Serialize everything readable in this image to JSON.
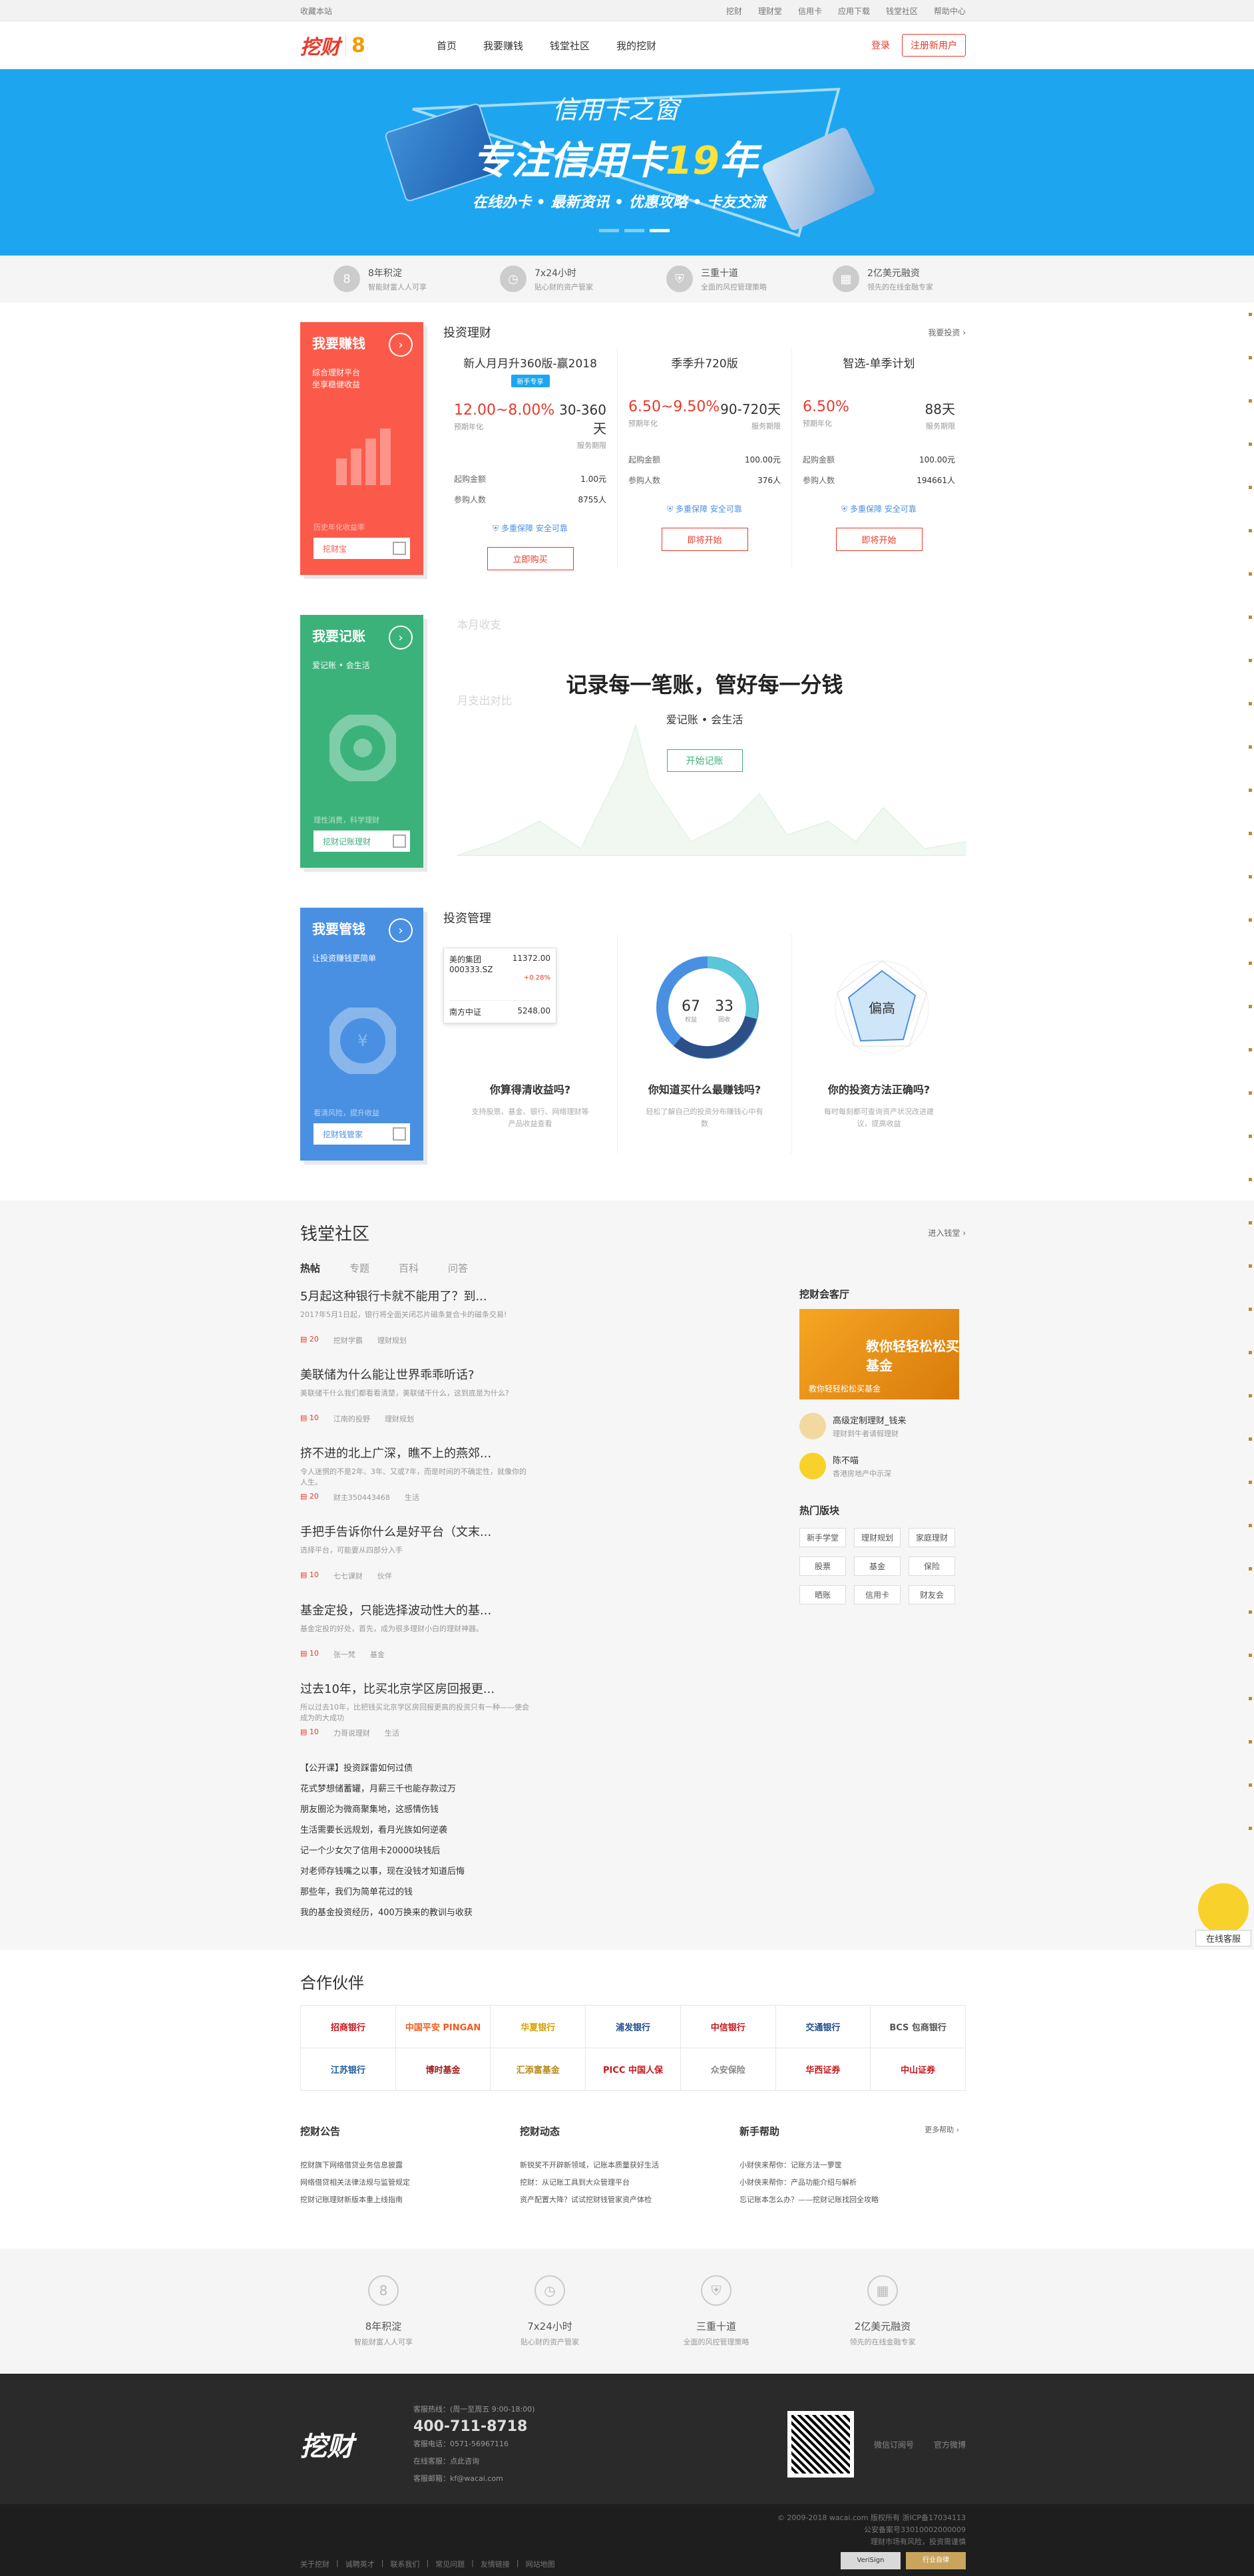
{
  "topbar": {
    "left": "收藏本站",
    "links": [
      "挖财",
      "理财堂",
      "信用卡",
      "应用下载",
      "钱堂社区",
      "帮助中心"
    ]
  },
  "header": {
    "logo": "挖财",
    "logo_mark": "8",
    "nav": [
      "首页",
      "我要赚钱",
      "钱堂社区",
      "我的挖财"
    ],
    "login": "登录",
    "register": "注册新用户"
  },
  "banner": {
    "subtitle": "信用卡之窗",
    "title_pre": "专注信用卡",
    "title_num": "19",
    "title_post": "年",
    "tags": "在线办卡 • 最新资讯 • 优惠攻略 • 卡友交流"
  },
  "features": [
    {
      "icon": "8",
      "t1": "8年积淀",
      "t2": "智能财富人人可享"
    },
    {
      "icon": "◷",
      "t1": "7x24小时",
      "t2": "贴心财的资产管家"
    },
    {
      "icon": "⛨",
      "t1": "三重十道",
      "t2": "全面的风控管理策略"
    },
    {
      "icon": "▦",
      "t1": "2亿美元融资",
      "t2": "领先的在线金融专家"
    }
  ],
  "earn": {
    "side_title": "我要赚钱",
    "side_desc1": "综合理财平台",
    "side_desc2": "坐享稳健收益",
    "side_foot": "历史年化收益率",
    "side_btn": "挖财宝",
    "panel_title": "投资理财",
    "more": "我要投资 ›",
    "products": [
      {
        "name": "新人月月升360版-赢2018",
        "tag": "新手专享",
        "rate": "12.00~8.00%",
        "days": "30-360天",
        "rate_lbl": "预期年化",
        "days_lbl": "服务期限",
        "buy_lbl": "起购金额",
        "buy": "1.00元",
        "people_lbl": "参购人数",
        "people": "8755人",
        "secure": "多重保障 安全可靠",
        "btn": "立即购买"
      },
      {
        "name": "季季升720版",
        "tag": "",
        "rate": "6.50~9.50%",
        "days": "90-720天",
        "rate_lbl": "预期年化",
        "days_lbl": "服务期限",
        "buy_lbl": "起购金额",
        "buy": "100.00元",
        "people_lbl": "参购人数",
        "people": "376人",
        "secure": "多重保障 安全可靠",
        "btn": "即将开始"
      },
      {
        "name": "智选-单季计划",
        "tag": "",
        "rate": "6.50%",
        "days": "88天",
        "rate_lbl": "预期年化",
        "days_lbl": "服务期限",
        "buy_lbl": "起购金额",
        "buy": "100.00元",
        "people_lbl": "参购人数",
        "people": "194661人",
        "secure": "多重保障 安全可靠",
        "btn": "即将开始"
      }
    ]
  },
  "record": {
    "side_title": "我要记账",
    "side_desc": "爱记账 • 会生活",
    "side_foot": "理性消费，科学理财",
    "side_btn": "挖财记账理财",
    "bg_title1": "本月收支",
    "bg_title2": "月支出对比",
    "big": "记录每一笔账，管好每一分钱",
    "sub": "爱记账 • 会生活",
    "btn": "开始记账"
  },
  "manage": {
    "side_title": "我要管钱",
    "side_desc": "让投资赚钱更简单",
    "side_foot": "看清风险，提升收益",
    "side_btn": "挖财钱管家",
    "panel_title": "投资管理",
    "stock1_name": "美的集团 000333.SZ",
    "stock1_val": "11372.00",
    "stock1_chg": "+0.28%",
    "stock2_name": "南方中证",
    "stock2_val": "5248.00",
    "donut_left": "67",
    "donut_left_lbl": "权益",
    "donut_right": "33",
    "donut_right_lbl": "固收",
    "radar_center": "偏高",
    "cards": [
      {
        "q": "你算得清收益吗?",
        "d": "支持股票、基金、银行、网络理财等产品收益查看"
      },
      {
        "q": "你知道买什么最赚钱吗?",
        "d": "轻松了解自己的投资分布赚钱心中有数"
      },
      {
        "q": "你的投资方法正确吗?",
        "d": "每时每刻都可查询资产状况改进建议，提高收益"
      }
    ]
  },
  "community": {
    "title": "钱堂社区",
    "more": "进入钱堂 ›",
    "tabs": [
      "热帖",
      "专题",
      "百科",
      "问答"
    ],
    "posts": [
      {
        "title": "5月起这种银行卡就不能用了？到...",
        "desc": "2017年5月1日起，银行将全面关闭芯片磁条复合卡的磁条交易!",
        "comments": "20",
        "author": "挖财学霸",
        "cat": "理财规划"
      },
      {
        "title": "美联储为什么能让世界乖乖听话?",
        "desc": "美联储干什么我们都看看清楚，美联储干什么，这到底是为什么?",
        "comments": "10",
        "author": "江南的投野",
        "cat": "理财规划"
      },
      {
        "title": "挤不进的北上广深，瞧不上的燕郊...",
        "desc": "令人迷惘的不是2年、3年、又或7年，而是时间的不确定性，就像你的人生。",
        "comments": "20",
        "author": "财主350443468",
        "cat": "生活"
      },
      {
        "title": "手把手告诉你什么是好平台（文末...",
        "desc": "选择平台，可能要从四部分入手",
        "comments": "10",
        "author": "七七课财",
        "cat": "伙伴"
      },
      {
        "title": "基金定投，只能选择波动性大的基...",
        "desc": "基金定投的好处，首先，成为很多理财小白的理财神器。",
        "comments": "10",
        "author": "张一梵",
        "cat": "基金"
      },
      {
        "title": "过去10年，比买北京学区房回报更...",
        "desc": "所以过去10年，比把钱买北京学区房回报更高的投资只有一种——使会成为的大成功",
        "comments": "10",
        "author": "力哥说理财",
        "cat": "生活"
      }
    ],
    "list_left": [
      "【公开课】投资踩雷如何过债",
      "花式梦想储蓄罐，月薪三千也能存款过万",
      "朋友圈沦为微商聚集地，这感情伤钱",
      "生活需要长远规划，看月光族如何逆袭"
    ],
    "list_right": [
      "记一个少女欠了信用卡20000块钱后",
      "对老师存钱嘴之以事，现在没钱才知道后悔",
      "那些年，我们为简单花过的钱",
      "我的基金投资经历，400万换来的教训与收获"
    ],
    "side_title": "挖财会客厅",
    "ad_text": "教你轻轻松松买基金",
    "ad_caption": "教你轻轻松松买基金",
    "users": [
      {
        "name": "高级定制理财_钱来",
        "desc": "理财到牛者请假理财"
      },
      {
        "name": "陈不喵",
        "desc": "香港房地产中示深"
      }
    ],
    "hot_title": "热门版块",
    "hot": [
      "新手学堂",
      "理财规划",
      "家庭理财",
      "股票",
      "基金",
      "保险",
      "晒账",
      "信用卡",
      "财友会"
    ]
  },
  "partners": {
    "title": "合作伙伴",
    "items": [
      {
        "name": "招商银行",
        "color": "#c8161d"
      },
      {
        "name": "中国平安 PINGAN",
        "color": "#f15a22"
      },
      {
        "name": "华夏银行",
        "color": "#d7a100"
      },
      {
        "name": "浦发银行",
        "color": "#1e4b8f"
      },
      {
        "name": "中信银行",
        "color": "#c8161d"
      },
      {
        "name": "交通银行",
        "color": "#1e4b8f"
      },
      {
        "name": "BCS 包商银行",
        "color": "#555555"
      },
      {
        "name": "江苏银行",
        "color": "#1e5c9e"
      },
      {
        "name": "博时基金",
        "color": "#a21c1c"
      },
      {
        "name": "汇添富基金",
        "color": "#b68a1a"
      },
      {
        "name": "PICC 中国人保",
        "color": "#c8161d"
      },
      {
        "name": "众安保险",
        "color": "#888888"
      },
      {
        "name": "华西证券",
        "color": "#c8161d"
      },
      {
        "name": "中山证券",
        "color": "#c8161d"
      }
    ]
  },
  "news": [
    {
      "title": "挖财公告",
      "more": "",
      "items": [
        "挖财旗下网络借贷业务信息披露",
        "网络借贷相关法律法规与监管规定",
        "挖财记账理财新版本重上线指南"
      ]
    },
    {
      "title": "挖财动态",
      "more": "",
      "items": [
        "新锐奖不开辟新领域，记账本质量获好生活",
        "挖财：从记账工具到大众管理平台",
        "资产配置大降？试试挖财钱管家资产体检"
      ]
    },
    {
      "title": "新手帮助",
      "more": "更多帮助 ›",
      "items": [
        "小财侠来帮你：记账方法一箩筐",
        "小财侠来帮你：产品功能介绍与解析",
        "忘记账本怎么办？——挖财记账找回全攻略"
      ]
    }
  ],
  "bottom_features": [
    {
      "icon": "8",
      "t1": "8年积淀",
      "t2": "智能财富人人可享"
    },
    {
      "icon": "◷",
      "t1": "7x24小时",
      "t2": "贴心财的资产管家"
    },
    {
      "icon": "⛨",
      "t1": "三重十道",
      "t2": "全面的风控管理策略"
    },
    {
      "icon": "▦",
      "t1": "2亿美元融资",
      "t2": "领先的在线金融专家"
    }
  ],
  "footer": {
    "logo": "挖财",
    "hotline_lbl": "客服热线：(周一至周五 9:00-18:00)",
    "phone": "400-711-8718",
    "fax": "客服电话：0571-56967116",
    "online": "在线客服：点此咨询",
    "email": "客服邮箱：kf@wacai.com",
    "wechat": "微信订阅号",
    "weibo": "官方微博",
    "links": [
      "关于挖财",
      "诚聘英才",
      "联系我们",
      "常见问题",
      "友情链接",
      "网站地图"
    ],
    "copyright": "© 2009-2018 wacai.com 版权所有 浙ICP备17034113",
    "police": "公安备案号33010002000009",
    "license": "理财市场有风险，投资需谨慎",
    "badge1": "VeriSign",
    "badge2": "行业自律"
  },
  "float_service": "在线客服"
}
